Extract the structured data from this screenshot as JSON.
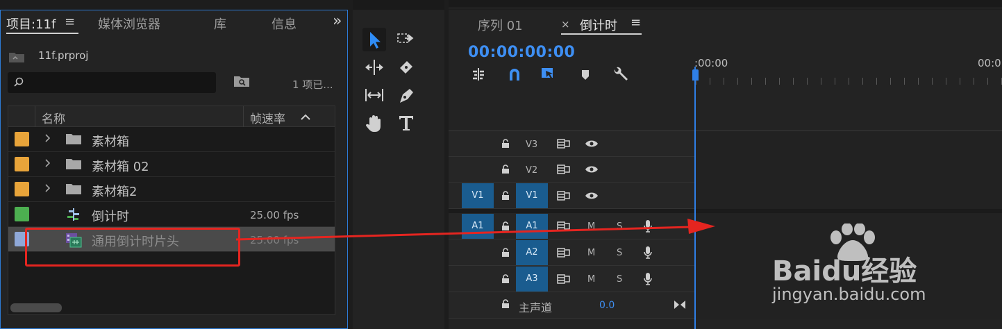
{
  "project_panel": {
    "tabs": [
      {
        "label": "项目:11f",
        "active": true
      },
      {
        "label": "媒体浏览器",
        "active": false
      },
      {
        "label": "库",
        "active": false
      },
      {
        "label": "信息",
        "active": false
      }
    ],
    "overflow_glyph": "»",
    "project_file": "11f.prproj",
    "search_value": "",
    "item_count": "1 项已...",
    "columns": {
      "name": "名称",
      "frame_rate": "帧速率"
    },
    "rows": [
      {
        "name": "素材箱",
        "fps": "",
        "color": "#e8a43a",
        "type": "folder",
        "expandable": true
      },
      {
        "name": "素材箱 02",
        "fps": "",
        "color": "#e8a43a",
        "type": "folder",
        "expandable": true
      },
      {
        "name": "素材箱2",
        "fps": "",
        "color": "#e8a43a",
        "type": "folder",
        "expandable": true
      },
      {
        "name": "倒计时",
        "fps": "25.00 fps",
        "color": "#4caf50",
        "type": "sequence",
        "expandable": false
      },
      {
        "name": "通用倒计时片头",
        "fps": "25.00 fps",
        "color": "#8fa8d8",
        "type": "clip",
        "expandable": false,
        "selected": true
      }
    ]
  },
  "timeline_panel": {
    "tabs": [
      {
        "label": "序列 01",
        "active": false
      },
      {
        "label": "倒计时",
        "active": true
      }
    ],
    "close_glyph": "×",
    "menu_glyph": "≡",
    "timecode": "00:00:00:00",
    "ruler_labels": [
      ":00:00",
      "00:0"
    ],
    "tracks": {
      "video": [
        {
          "label": "V3",
          "target": false
        },
        {
          "label": "V2",
          "target": false
        },
        {
          "label": "V1",
          "target": true,
          "source": "V1"
        }
      ],
      "audio": [
        {
          "label": "A1",
          "target": true,
          "source": "A1"
        },
        {
          "label": "A2",
          "target": true
        },
        {
          "label": "A3",
          "target": true
        }
      ],
      "mute_label": "M",
      "solo_label": "S",
      "master_label": "主声道",
      "master_value": "0.0"
    }
  },
  "colors": {
    "accent": "#2f7fe6",
    "annotation": "#e52520",
    "target_track": "#1a5c8f"
  },
  "watermark": {
    "brand": "Baidu经验",
    "url": "jingyan.baidu.com"
  }
}
